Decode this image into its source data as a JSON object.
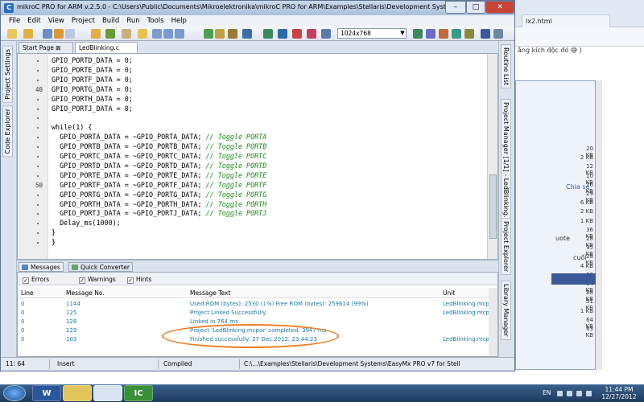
{
  "window": {
    "title": "mikroC PRO for ARM v.2.5.0 - C:\\Users\\Public\\Documents\\Mikroelektronika\\mikroC PRO for ARM\\Examples\\Stellaris\\Development Systems\\EasyMx PRO v7 for Stell...",
    "app_icon": "mikroC-icon"
  },
  "menu": [
    "File",
    "Edit",
    "View",
    "Project",
    "Build",
    "Run",
    "Tools",
    "Help"
  ],
  "toolbar": {
    "resolution": "1024x768"
  },
  "left_panel_tabs": [
    "Project Settings",
    "Code Explorer"
  ],
  "right_panel_tabs": [
    "Routine List",
    "Project Manager [1/1] - LedBlinking.mcpar",
    "Project Explorer",
    "Library Manager"
  ],
  "editor_tabs": [
    "Start Page",
    "LedBlinking.c"
  ],
  "code_lines": [
    {
      "ln": "",
      "text": "GPIO_PORTD_DATA = 0;",
      "comment": ""
    },
    {
      "ln": "",
      "text": "GPIO_PORTE_DATA = 0;",
      "comment": ""
    },
    {
      "ln": "",
      "text": "GPIO_PORTF_DATA = 0;",
      "comment": ""
    },
    {
      "ln": "40",
      "text": "GPIO_PORTG_DATA = 0;",
      "comment": ""
    },
    {
      "ln": "",
      "text": "GPIO_PORTH_DATA = 0;",
      "comment": ""
    },
    {
      "ln": "",
      "text": "GPIO_PORTJ_DATA = 0;",
      "comment": ""
    },
    {
      "ln": "",
      "text": "",
      "comment": ""
    },
    {
      "ln": "",
      "text": "while(1) {",
      "comment": ""
    },
    {
      "ln": "",
      "text": "  GPIO_PORTA_DATA = ~GPIO_PORTA_DATA; ",
      "comment": "// Toggle PORTA"
    },
    {
      "ln": "",
      "text": "  GPIO_PORTB_DATA = ~GPIO_PORTB_DATA; ",
      "comment": "// Toggle PORTB"
    },
    {
      "ln": "",
      "text": "  GPIO_PORTC_DATA = ~GPIO_PORTC_DATA; ",
      "comment": "// Toggle PORTC"
    },
    {
      "ln": "",
      "text": "  GPIO_PORTD_DATA = ~GPIO_PORTD_DATA; ",
      "comment": "// Toggle PORTD"
    },
    {
      "ln": "",
      "text": "  GPIO_PORTE_DATA = ~GPIO_PORTE_DATA; ",
      "comment": "// Toggle PORTE"
    },
    {
      "ln": "50",
      "text": "  GPIO_PORTF_DATA = ~GPIO_PORTF_DATA; ",
      "comment": "// Toggle PORTF"
    },
    {
      "ln": "",
      "text": "  GPIO_PORTG_DATA = ~GPIO_PORTG_DATA; ",
      "comment": "// Toggle PORTG"
    },
    {
      "ln": "",
      "text": "  GPIO_PORTH_DATA = ~GPIO_PORTH_DATA; ",
      "comment": "// Toggle PORTH"
    },
    {
      "ln": "",
      "text": "  GPIO_PORTJ_DATA = ~GPIO_PORTJ_DATA; ",
      "comment": "// Toggle PORTJ"
    },
    {
      "ln": "",
      "text": "  Delay_ms(1000);",
      "comment": ""
    },
    {
      "ln": "",
      "text": "}",
      "comment": ""
    },
    {
      "ln": "",
      "text": "}",
      "comment": ""
    }
  ],
  "messages": {
    "tabs": [
      "Messages",
      "Quick Converter"
    ],
    "filters": [
      "Errors",
      "Warnings",
      "Hints"
    ],
    "columns": [
      "Line",
      "Message No.",
      "Message Text",
      "Unit"
    ],
    "rows": [
      {
        "line": "0",
        "no": "1144",
        "text": "Used ROM (bytes): 2530 (1%)  Free ROM (bytes): 259614 (99%)",
        "unit": "LedBlinking.mcpar"
      },
      {
        "line": "0",
        "no": "125",
        "text": "Project Linked Successfully",
        "unit": "LedBlinking.mcpar"
      },
      {
        "line": "0",
        "no": "128",
        "text": "Linked in 764 ms",
        "unit": ""
      },
      {
        "line": "0",
        "no": "129",
        "text": "Project 'LedBlinking.mcpar' completed: 3947 ms",
        "unit": ""
      },
      {
        "line": "0",
        "no": "103",
        "text": "Finished successfully: 27 Dec 2012, 23:44:23",
        "unit": "LedBlinking.mcpar"
      }
    ]
  },
  "status": {
    "position": "11: 64",
    "mode": "Insert",
    "state": "Compiled",
    "path": "C:\\...\\Examples\\Stellaris\\Development Systems\\EasyMx PRO v7 for Stell"
  },
  "background": {
    "tab": "lx2.html",
    "snippet": "ằng kích độc đó 😅 )",
    "kb_sizes": [
      "20 KB",
      "2 KB",
      "12 KB",
      "10 KB",
      "76 KB",
      "29 KB",
      "6 KB",
      "2 KB",
      "1 KB",
      "36 KB",
      "28 KB",
      "95 KB",
      "28 KB",
      "4 KB",
      "52 KB",
      "84 KB",
      "88 KB",
      "51 KB",
      "1 KB",
      "64 KB",
      "63 KB"
    ],
    "link_chia_se": "Chia sẻ",
    "quote": "uote",
    "cuoi": "cuối"
  },
  "taskbar": {
    "lang": "EN",
    "time": "11:44 PM",
    "date": "12/27/2012",
    "apps": [
      "W",
      "",
      "",
      "IC"
    ]
  }
}
